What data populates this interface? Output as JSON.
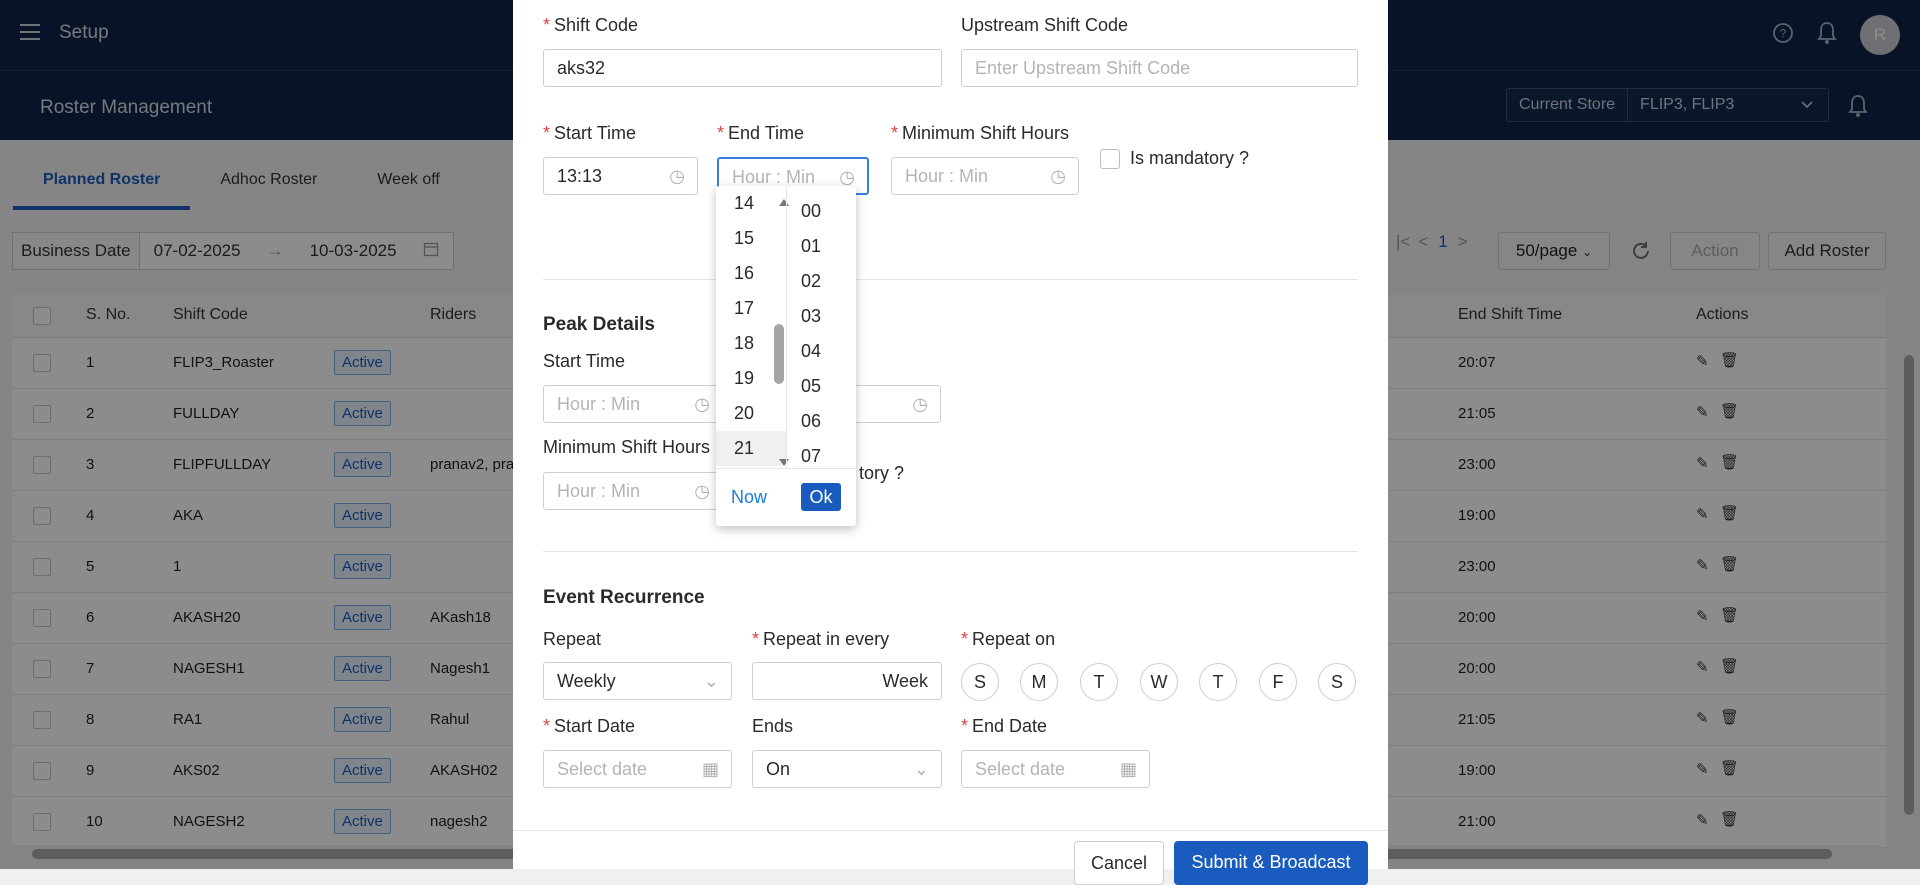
{
  "app": {
    "title": "Setup",
    "avatar_initial": "R"
  },
  "header": {
    "page_title": "Roster Management",
    "store_label": "Current Store",
    "store_value": "FLIP3, FLIP3"
  },
  "tabs": [
    "Planned Roster",
    "Adhoc Roster",
    "Week off"
  ],
  "filters": {
    "business_date_label": "Business Date",
    "start_date": "07-02-2025",
    "end_date": "10-03-2025"
  },
  "pagination": {
    "page": "1",
    "per_page": "50/page"
  },
  "toolbar": {
    "action_label": "Action",
    "add_label": "Add Roster"
  },
  "table": {
    "headers": [
      "S. No.",
      "Shift Code",
      "Riders",
      "End Shift Time",
      "Actions"
    ],
    "rows": [
      {
        "sno": "1",
        "code": "FLIP3_Roaster",
        "status": "Active",
        "riders": "",
        "end": "20:07"
      },
      {
        "sno": "2",
        "code": "FULLDAY",
        "status": "Active",
        "riders": "",
        "end": "21:05"
      },
      {
        "sno": "3",
        "code": "FLIPFULLDAY",
        "status": "Active",
        "riders": "pranav2, pra",
        "end": "23:00"
      },
      {
        "sno": "4",
        "code": "AKA",
        "status": "Active",
        "riders": "",
        "end": "19:00"
      },
      {
        "sno": "5",
        "code": "1",
        "status": "Active",
        "riders": "",
        "end": "23:00"
      },
      {
        "sno": "6",
        "code": "AKASH20",
        "status": "Active",
        "riders": "AKash18",
        "end": "20:00"
      },
      {
        "sno": "7",
        "code": "NAGESH1",
        "status": "Active",
        "riders": "Nagesh1",
        "end": "20:00"
      },
      {
        "sno": "8",
        "code": "RA1",
        "status": "Active",
        "riders": "Rahul",
        "end": "21:05"
      },
      {
        "sno": "9",
        "code": "AKS02",
        "status": "Active",
        "riders": "AKASH02",
        "end": "19:00"
      },
      {
        "sno": "10",
        "code": "NAGESH2",
        "status": "Active",
        "riders": "nagesh2",
        "end": "21:00"
      }
    ]
  },
  "modal": {
    "shift_code_label": "Shift Code",
    "shift_code_value": "aks32",
    "upstream_label": "Upstream Shift Code",
    "upstream_placeholder": "Enter Upstream Shift Code",
    "start_time_label": "Start Time",
    "start_time_value": "13:13",
    "end_time_label": "End Time",
    "end_time_placeholder": "Hour : Min",
    "min_hours_label": "Minimum Shift Hours",
    "min_hours_placeholder": "Hour : Min",
    "mandatory_label": "Is mandatory ?",
    "peak_title": "Peak Details",
    "peak_start_label": "Start Time",
    "peak_start_placeholder": "Hour : Min",
    "peak_min_hours_label": "Minimum Shift Hours",
    "peak_min_placeholder": "Hour : Min",
    "peak_mandatory_partial": "tory ?",
    "recurrence_title": "Event Recurrence",
    "repeat_label": "Repeat",
    "repeat_value": "Weekly",
    "repeat_every_label": "Repeat in every",
    "repeat_every_unit": "Week",
    "repeat_on_label": "Repeat on",
    "days": [
      "S",
      "M",
      "T",
      "W",
      "T",
      "F",
      "S"
    ],
    "start_date_label": "Start Date",
    "start_date_placeholder": "Select date",
    "ends_label": "Ends",
    "ends_value": "On",
    "end_date_label": "End Date",
    "end_date_placeholder": "Select date",
    "cancel_label": "Cancel",
    "submit_label": "Submit & Broadcast"
  },
  "time_picker": {
    "hours": [
      "14",
      "15",
      "16",
      "17",
      "18",
      "19",
      "20",
      "21"
    ],
    "selected_hour": "21",
    "minutes": [
      "00",
      "01",
      "02",
      "03",
      "04",
      "05",
      "06",
      "07"
    ],
    "now_label": "Now",
    "ok_label": "Ok"
  },
  "colors": {
    "nav": "#0f2447",
    "primary": "#1a5bbf",
    "required": "#e24444"
  },
  "icons": [
    "menu-icon",
    "help-icon",
    "bell-icon",
    "clock-icon",
    "calendar-icon",
    "chevron-down-icon",
    "edit-icon",
    "delete-icon",
    "refresh-icon"
  ]
}
